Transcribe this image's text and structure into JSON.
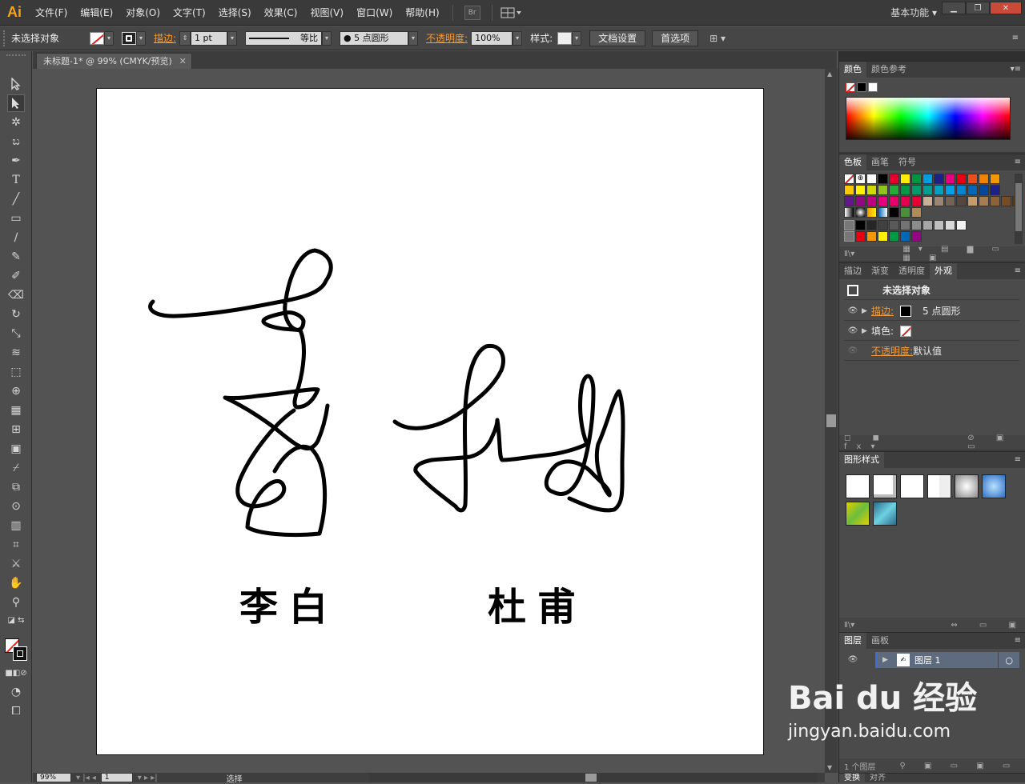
{
  "app": {
    "logo": "Ai"
  },
  "menu": [
    "文件(F)",
    "编辑(E)",
    "对象(O)",
    "文字(T)",
    "选择(S)",
    "效果(C)",
    "视图(V)",
    "窗口(W)",
    "帮助(H)"
  ],
  "bridge_label": "Br",
  "workspace_label": "基本功能",
  "control": {
    "selection": "未选择对象",
    "stroke_label": "描边:",
    "stroke_weight": "1 pt",
    "stroke_profile": "等比",
    "brush": "5 点圆形",
    "opacity_label": "不透明度:",
    "opacity_value": "100%",
    "style_label": "样式:",
    "doc_setup": "文档设置",
    "preferences": "首选项"
  },
  "document": {
    "tab_title": "未标题-1* @ 99% (CMYK/预览)",
    "labels": [
      "李白",
      "杜甫"
    ]
  },
  "status": {
    "zoom": "99%",
    "page": "1",
    "tool": "选择"
  },
  "panels": {
    "color": {
      "tabs": [
        "颜色",
        "颜色参考"
      ]
    },
    "swatches": {
      "tabs": [
        "色板",
        "画笔",
        "符号"
      ]
    },
    "appearance": {
      "tabs": [
        "描边",
        "渐变",
        "透明度",
        "外观"
      ],
      "title": "未选择对象",
      "stroke_label": "描边:",
      "stroke_value": "5 点圆形",
      "fill_label": "填色:",
      "opacity_label": "不透明度:",
      "opacity_value": "默认值"
    },
    "graphic_styles": {
      "tabs": [
        "图形样式"
      ]
    },
    "layers": {
      "tabs": [
        "图层",
        "画板"
      ],
      "layer_name": "图层 1",
      "count": "1 个图层"
    },
    "bottom": {
      "tabs": [
        "变换",
        "对齐"
      ]
    }
  },
  "watermark": {
    "brand": "Bai du 经验",
    "url": "jingyan.baidu.com"
  },
  "colors": {
    "accent": "#f29b38",
    "swatch_row1": [
      "#ffffff",
      "#000000",
      "#e4002b",
      "#ffed00",
      "#00963f",
      "#009ee0",
      "#1d2088",
      "#e5007f",
      "#e60012",
      "#e84f1c",
      "#f08300",
      "#f39800"
    ],
    "swatch_row2": [
      "#fcc800",
      "#fff100",
      "#cfdb00",
      "#8fc31f",
      "#22ac38",
      "#009944",
      "#009b6b",
      "#009e96",
      "#00a0c1",
      "#00a0e9",
      "#0086d1",
      "#0068b7",
      "#00479d",
      "#1d2088"
    ],
    "swatch_row3": [
      "#601986",
      "#920783",
      "#be0081",
      "#e4007f",
      "#e5006a",
      "#e5004f",
      "#e60033",
      "#c7b299",
      "#998675",
      "#736357",
      "#534741",
      "#c69c6d",
      "#a67c52",
      "#8c6239",
      "#754c24",
      "#603813"
    ],
    "swatch_gray": [
      "#000000",
      "#262626",
      "#404040",
      "#595959",
      "#737373",
      "#8c8c8c",
      "#a6a6a6",
      "#bfbfbf",
      "#d9d9d9",
      "#f2f2f2"
    ],
    "swatch_bright": [
      "#e60012",
      "#f39800",
      "#fff100",
      "#009944",
      "#0068b7",
      "#920783"
    ]
  }
}
